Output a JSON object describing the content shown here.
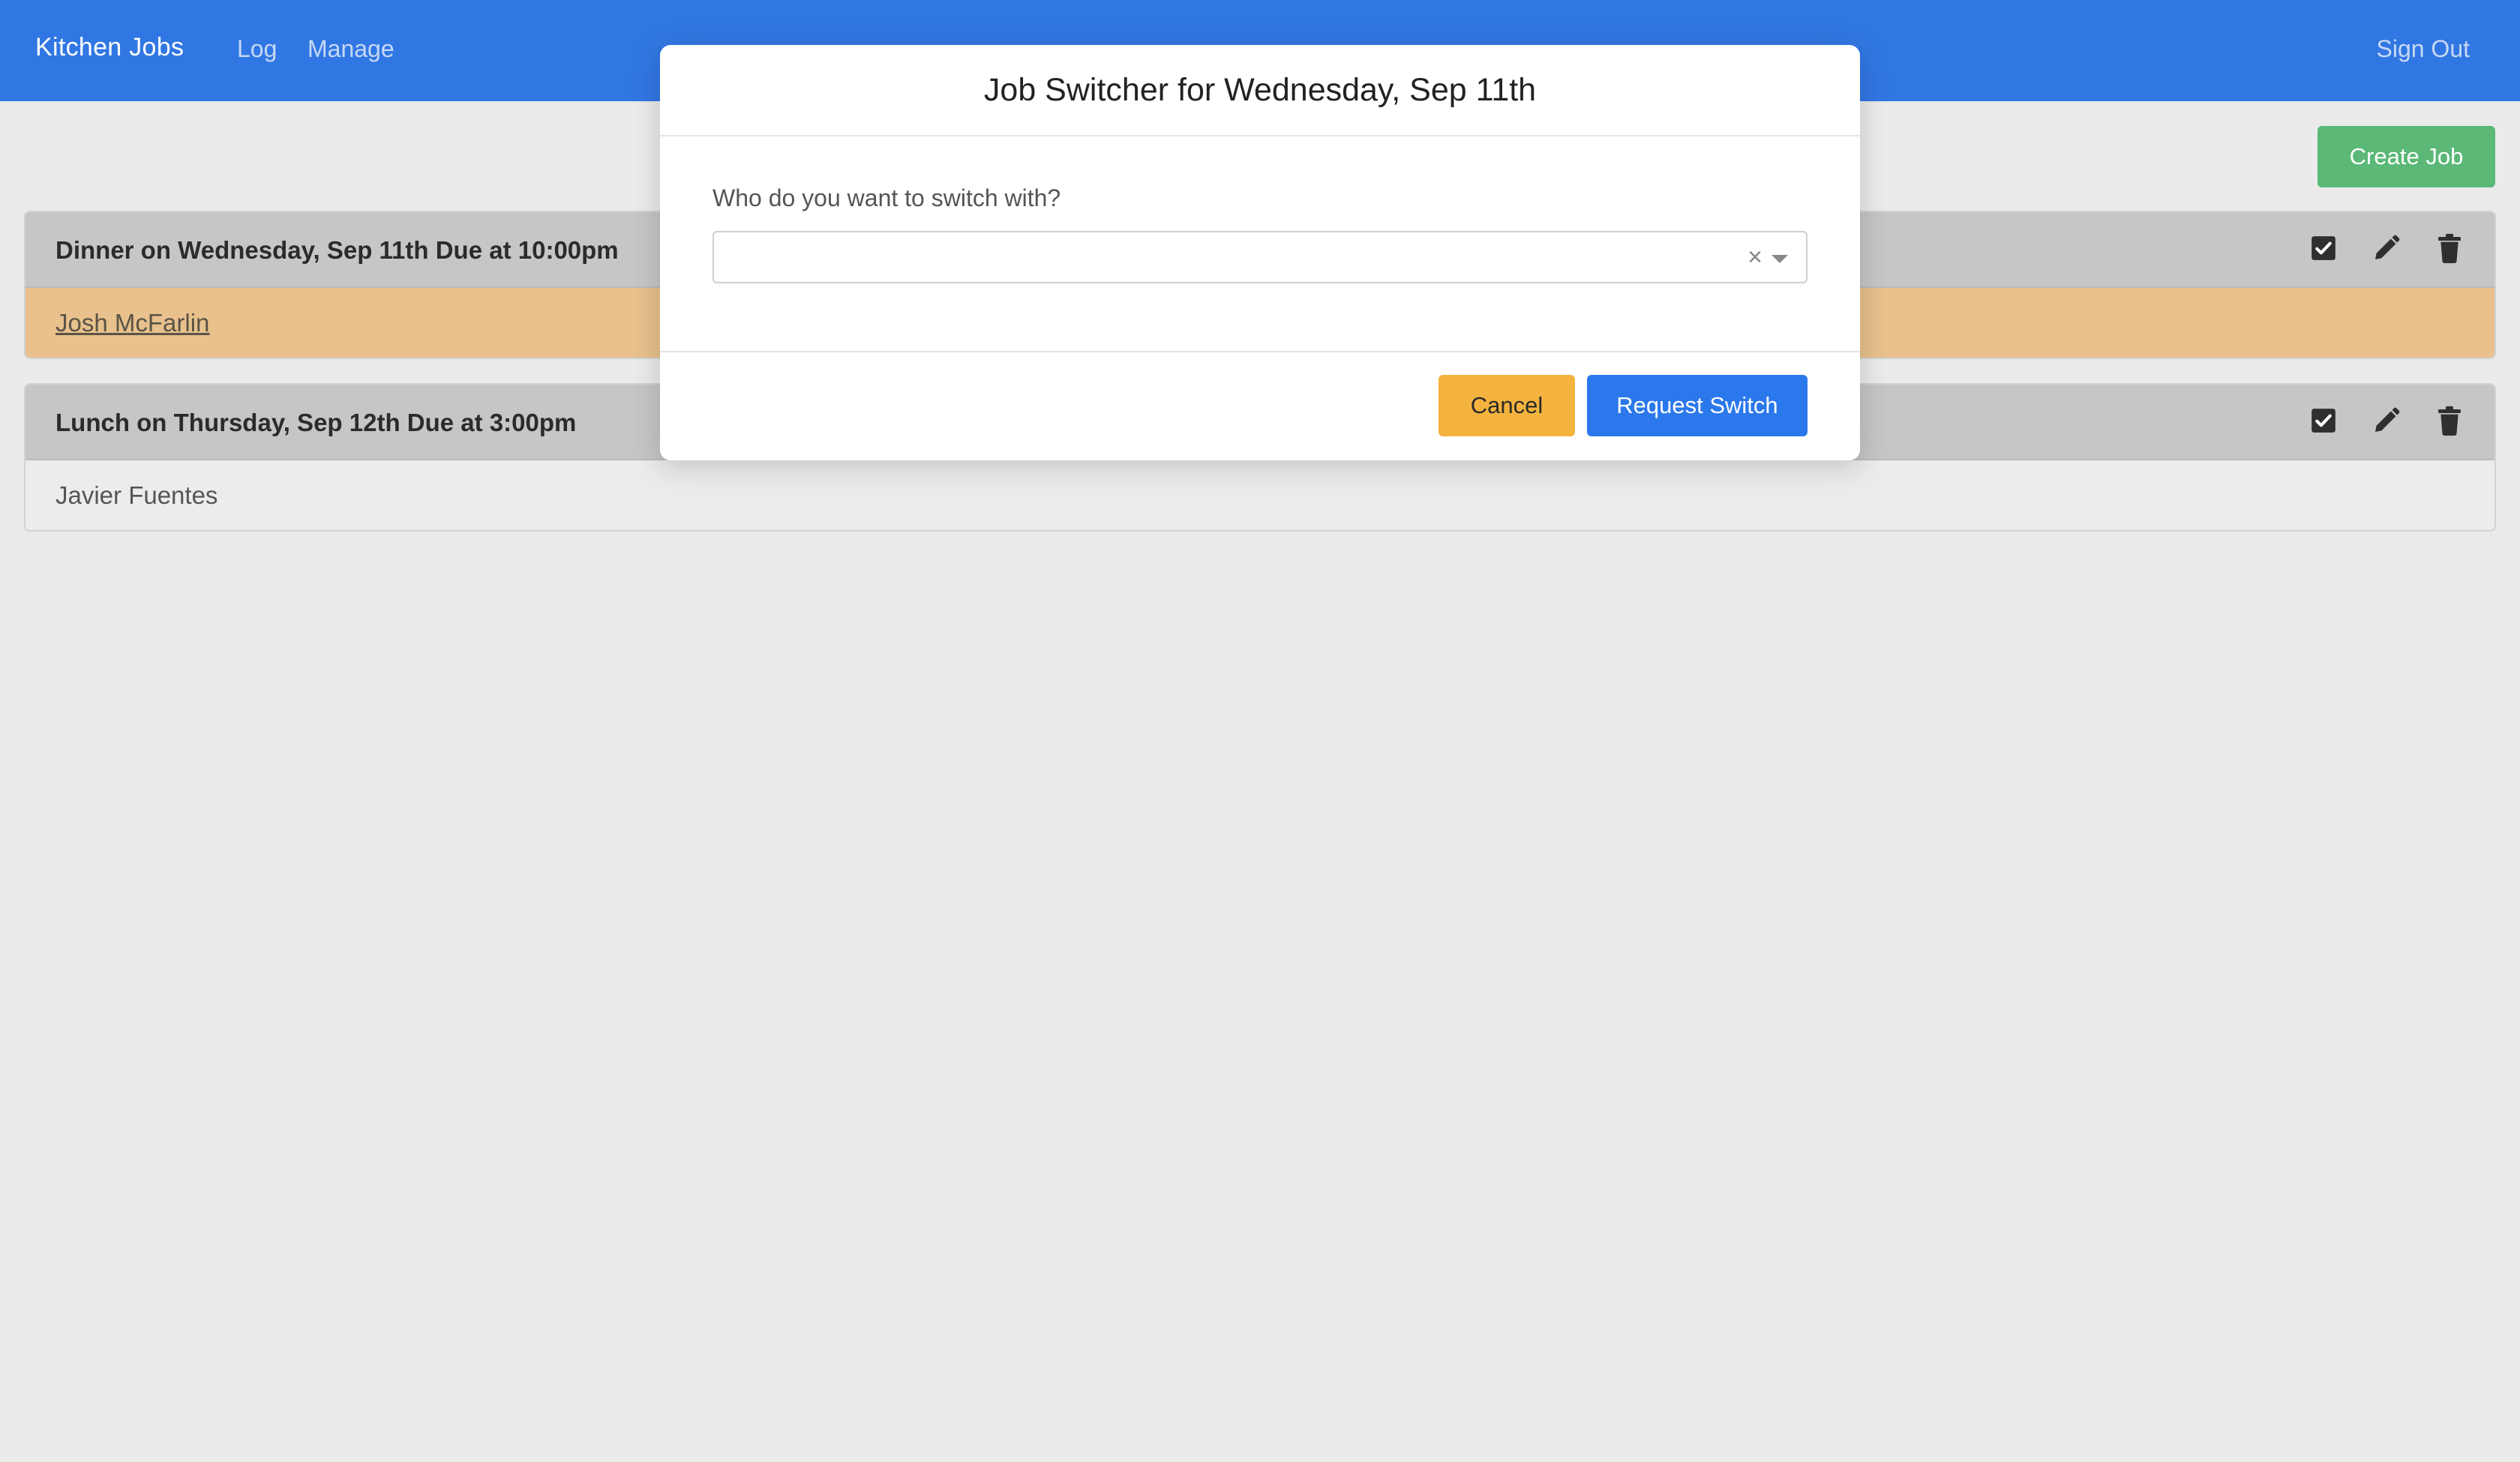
{
  "navbar": {
    "brand": "Kitchen Jobs",
    "links": [
      {
        "label": "Log"
      },
      {
        "label": "Manage"
      }
    ],
    "sign_out": "Sign Out"
  },
  "toolbar": {
    "create_job_label": "Create Job"
  },
  "jobs": [
    {
      "title": "Dinner on Wednesday, Sep 11th Due at 10:00pm",
      "assignee": "Josh McFarlin",
      "icons": [
        "check-square-icon",
        "pencil-icon",
        "trash-icon"
      ]
    },
    {
      "title": "Lunch on Thursday, Sep 12th Due at 3:00pm",
      "assignee": "Javier Fuentes",
      "icons": [
        "check-square-icon",
        "pencil-icon",
        "trash-icon"
      ]
    }
  ],
  "modal": {
    "title": "Job Switcher for Wednesday, Sep 11th",
    "field_label": "Who do you want to switch with?",
    "select_value": "",
    "clear_symbol": "×",
    "cancel_label": "Cancel",
    "request_label": "Request Switch"
  },
  "colors": {
    "navbar": "#3177e3",
    "create_job": "#5bb877",
    "highlight_row": "#e8c18d",
    "cancel": "#f3b33e",
    "request": "#2b78ec"
  }
}
